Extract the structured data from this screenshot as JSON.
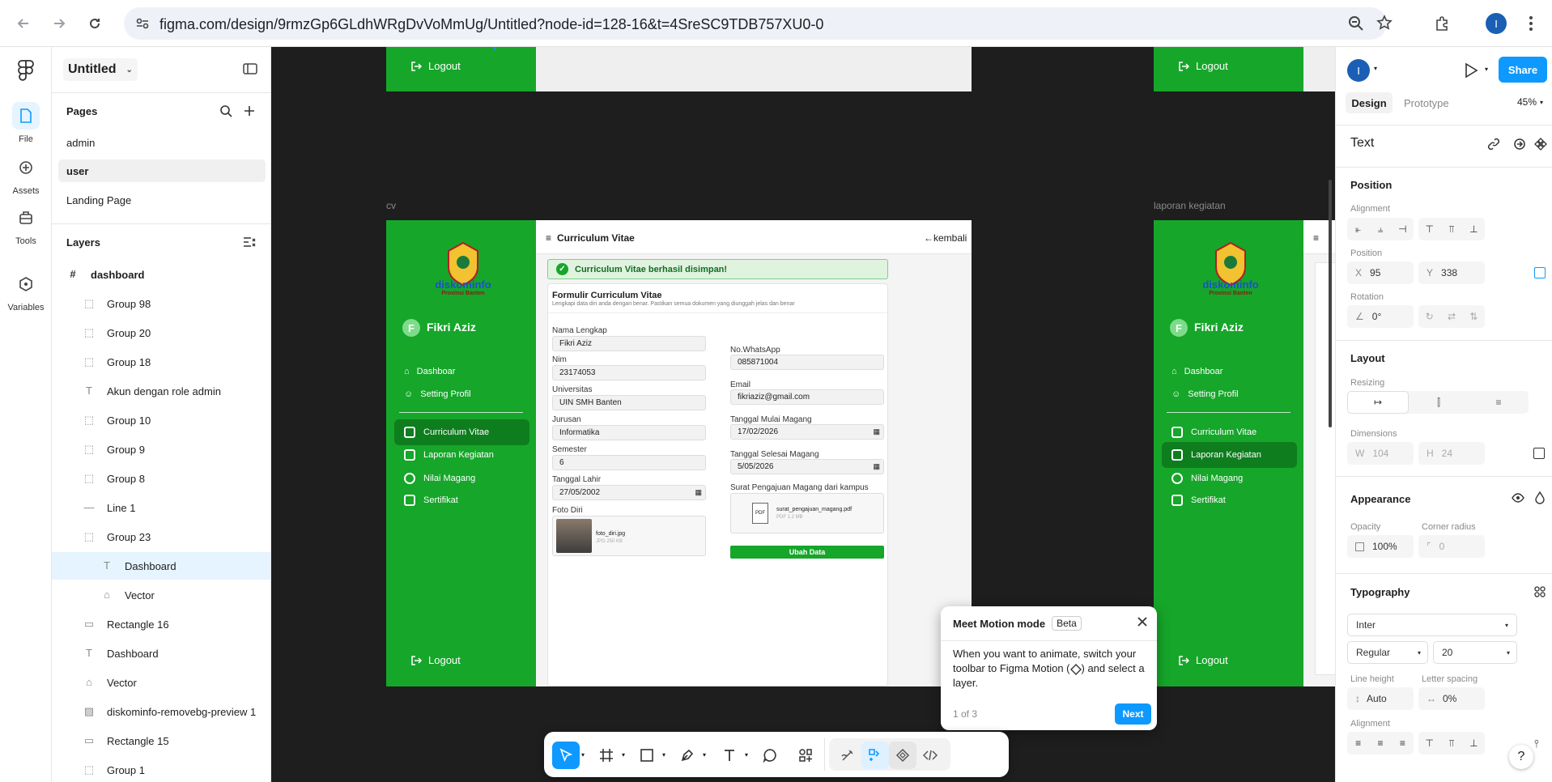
{
  "browser": {
    "url": "figma.com/design/9rmzGp6GLdhWRgDvVoMmUg/Untitled?node-id=128-16&t=4SreSC9TDB757XU0-0",
    "profile_initial": "I"
  },
  "rail": {
    "file": "File",
    "assets": "Assets",
    "tools": "Tools",
    "variables": "Variables"
  },
  "left_panel": {
    "file_name": "Untitled",
    "pages_title": "Pages",
    "pages": [
      "admin",
      "user",
      "Landing Page"
    ],
    "layers_title": "Layers",
    "root_layer": "dashboard",
    "layers": [
      "Group 98",
      "Group 20",
      "Group 18",
      "Akun dengan role admin",
      "Group 10",
      "Group 9",
      "Group 8",
      "Line 1",
      "Group 23",
      "Dashboard",
      "Vector",
      "Rectangle 16",
      "Dashboard",
      "Vector",
      "diskominfo-removebg-preview 1",
      "Rectangle 15",
      "Group 1"
    ]
  },
  "canvas": {
    "frame_cv_label": "cv",
    "frame_laporan_label": "laporan kegiatan",
    "logout": "Logout",
    "logo_text": "diskominfo",
    "logo_sub": "Provinsi Banten",
    "user_name": "Fikri Aziz",
    "user_initial": "F",
    "nav": [
      "Dashboar",
      "Setting Profil",
      "Curriculum Vitae",
      "Laporan Kegiatan",
      "Nilai Magang",
      "Sertifikat"
    ],
    "header_title": "Curriculum Vitae",
    "back": "kembali",
    "success": "Curriculum Vitae berhasil disimpan!",
    "form_title": "Formulir Curriculum Vitae",
    "form_sub": "Lengkapi data diri anda dengan benar. Pastikan semua dokumen yang diunggah jelas dan benar",
    "fields": {
      "nama_label": "Nama Lengkap",
      "nama": "Fikri Aziz",
      "nim_label": "Nim",
      "nim": "23174053",
      "univ_label": "Universitas",
      "univ": "UIN SMH Banten",
      "jurusan_label": "Jurusan",
      "jurusan": "Informatika",
      "semester_label": "Semester",
      "semester": "6",
      "lahir_label": "Tanggal Lahir",
      "lahir": "27/05/2002",
      "foto_label": "Foto Diri",
      "foto_file": "foto_diri.jpg",
      "foto_size": "JPG 250 KB",
      "wa_label": "No.WhatsApp",
      "wa": "085871004",
      "email_label": "Email",
      "email": "fikriaziz@gmail.com",
      "mulai_label": "Tanggal Mulai Magang",
      "mulai": "17/02/2026",
      "selesai_label": "Tanggal Selesai Magang",
      "selesai": "5/05/2026",
      "surat_label": "Surat Pengajuan Magang dari kampus",
      "surat_file": "surat_pengajuan_magang.pdf",
      "surat_size": "PDF 1.2 MB",
      "pdf": "PDF"
    },
    "ubah": "Ubah Data"
  },
  "right_panel": {
    "avatar_initial": "I",
    "share": "Share",
    "tab_design": "Design",
    "tab_prototype": "Prototype",
    "zoom": "45%",
    "element_type": "Text",
    "position_title": "Position",
    "alignment_label": "Alignment",
    "position_label": "Position",
    "x_label": "X",
    "x": "95",
    "y_label": "Y",
    "y": "338",
    "rotation_label": "Rotation",
    "rotation": "0°",
    "layout_title": "Layout",
    "resizing_label": "Resizing",
    "dimensions_label": "Dimensions",
    "w_label": "W",
    "w": "104",
    "h_label": "H",
    "h": "24",
    "appearance_title": "Appearance",
    "opacity_label": "Opacity",
    "opacity": "100%",
    "radius_label": "Corner radius",
    "radius": "0",
    "typography_title": "Typography",
    "font": "Inter",
    "weight": "Regular",
    "size": "20",
    "line_height_label": "Line height",
    "line_height": "Auto",
    "letter_spacing_label": "Letter spacing",
    "letter_spacing": "0%",
    "align_label": "Alignment"
  },
  "popup": {
    "title": "Meet Motion mode",
    "badge": "Beta",
    "body1": "When you want to animate, switch your toolbar to Figma Motion (",
    "body2": ") and select a layer.",
    "count": "1 of 3",
    "next": "Next"
  },
  "colors": {
    "green": "#16a62a",
    "blue": "#0d99ff",
    "canvas": "#1e1e1e"
  }
}
